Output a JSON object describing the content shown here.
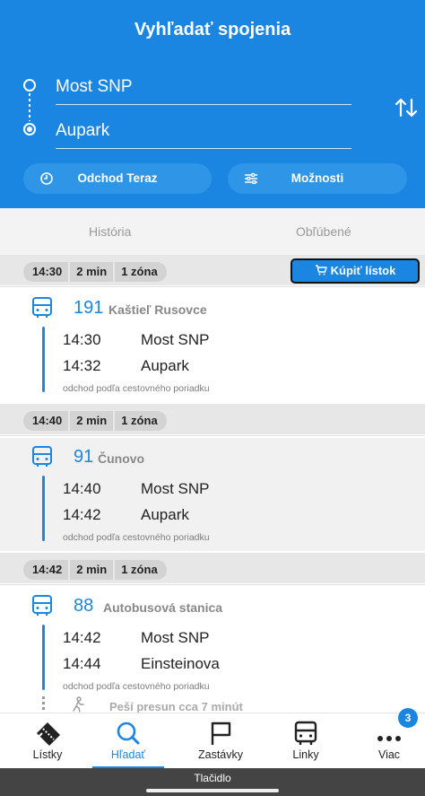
{
  "header": {
    "title": "Vyhľadať spojenia",
    "from": "Most SNP",
    "to": "Aupark",
    "departure_label": "Odchod Teraz",
    "options_label": "Možnosti"
  },
  "tabs": {
    "history": "História",
    "favorites": "Obľúbené"
  },
  "buy_ticket_label": "Kúpiť lístok",
  "connections": [
    {
      "depart": "14:30",
      "duration": "2 min",
      "zones": "1 zóna",
      "line": "191",
      "destination": "Kaštieľ Rusovce",
      "stops": [
        {
          "time": "14:30",
          "name": "Most SNP"
        },
        {
          "time": "14:32",
          "name": "Aupark"
        }
      ],
      "note": "odchod podľa cestovného poriadku"
    },
    {
      "depart": "14:40",
      "duration": "2 min",
      "zones": "1 zóna",
      "line": "91",
      "destination": "Čunovo",
      "stops": [
        {
          "time": "14:40",
          "name": "Most SNP"
        },
        {
          "time": "14:42",
          "name": "Aupark"
        }
      ],
      "note": "odchod podľa cestovného poriadku"
    },
    {
      "depart": "14:42",
      "duration": "2 min",
      "zones": "1 zóna",
      "line": "88",
      "destination": "Autobusová stanica",
      "stops": [
        {
          "time": "14:42",
          "name": "Most SNP"
        },
        {
          "time": "14:44",
          "name": "Einsteinova"
        }
      ],
      "note": "odchod podľa cestovného poriadku",
      "walk": "Peší presun cca 7 minút"
    }
  ],
  "nav": {
    "items": [
      {
        "label": "Lístky",
        "icon": "ticket-icon"
      },
      {
        "label": "Hľadať",
        "icon": "search-icon"
      },
      {
        "label": "Zastávky",
        "icon": "flag-icon"
      },
      {
        "label": "Linky",
        "icon": "bus-icon"
      },
      {
        "label": "Viac",
        "icon": "more-icon"
      }
    ],
    "badge": "3"
  },
  "bottom_bar_label": "Tlačidlo",
  "colors": {
    "brand": "#1a86e1",
    "header_pill": "#2f95e6"
  }
}
